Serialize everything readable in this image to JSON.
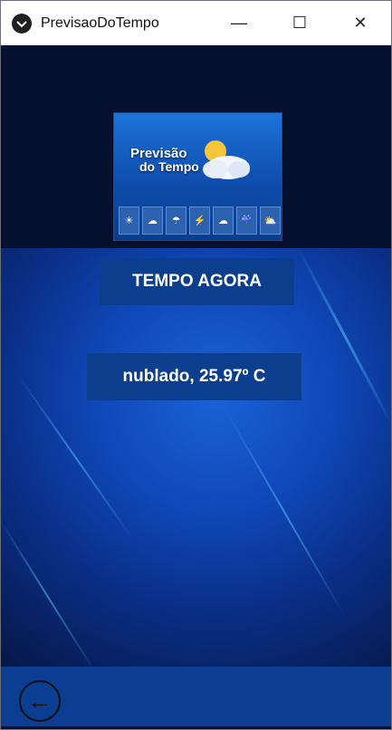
{
  "window": {
    "title": "PrevisaoDoTempo",
    "controls": {
      "minimize": "—",
      "maximize": "☐",
      "close": "✕"
    }
  },
  "logo": {
    "line1": "Previsão",
    "line2": "do Tempo",
    "weather_icons": [
      "sun-icon",
      "cloud-icon",
      "rain-icon",
      "storm-icon",
      "cloud-icon",
      "rain-icon",
      "sun-cloud-icon"
    ]
  },
  "main": {
    "heading": "TEMPO AGORA",
    "weather_text": "nublado, 25.97º C"
  },
  "bottom": {
    "back_icon": "←"
  },
  "colors": {
    "accent": "#0b3e8c",
    "bottom_bar": "#0b3d92",
    "top_bg": "#04102e"
  }
}
